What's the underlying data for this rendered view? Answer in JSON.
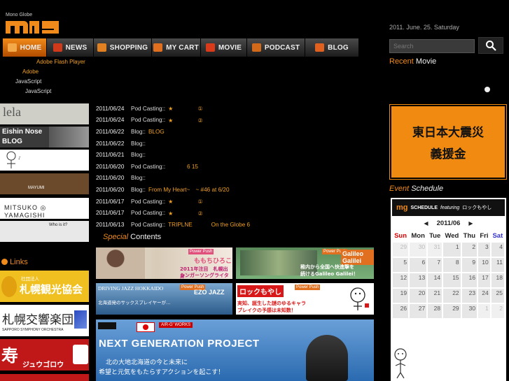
{
  "logo": {
    "small_text": "Mono Globe",
    "mark_text": "mg"
  },
  "nav": [
    {
      "label": "HOME",
      "icon": "home-icon",
      "active": true,
      "color": "#f3a94a"
    },
    {
      "label": "NEWS",
      "icon": "news-icon",
      "active": false,
      "color": "#d03a1a"
    },
    {
      "label": "SHOPPING",
      "icon": "shopping-icon",
      "active": false,
      "color": "#e08020"
    },
    {
      "label": "MY CART",
      "icon": "cart-icon",
      "active": false,
      "color": "#e07020"
    },
    {
      "label": "MOVIE",
      "icon": "movie-icon",
      "active": false,
      "color": "#d83a1a"
    },
    {
      "label": "PODCAST",
      "icon": "podcast-icon",
      "active": false,
      "color": "#d06a1a"
    },
    {
      "label": "BLOG",
      "icon": "blog-icon",
      "active": false,
      "color": "#e06020"
    }
  ],
  "header": {
    "date": "2011. June. 25. Saturday",
    "search_placeholder": "Search"
  },
  "notice": {
    "line1": "Adobe Flash Player",
    "line2": "Adobe",
    "line3": "JavaScript",
    "line4": "JavaScript"
  },
  "recent_movie": {
    "title_hl": "Recent",
    "title_rest": " Movie"
  },
  "left_banners": [
    {
      "name": "lela-banner",
      "text": "lela",
      "bg": "#cfcfc7"
    },
    {
      "name": "eishin-nose-blog-banner",
      "text": "Eishin Nose",
      "text2": "BLOG",
      "bg": "#3a3a3a"
    },
    {
      "name": "character-banner",
      "text": "",
      "bg": "#ffffff"
    },
    {
      "name": "mayumi-banner",
      "text": "MAYUMI",
      "bg": "#6a4a2a"
    },
    {
      "name": "mitsuko-yamagishi-banner",
      "text": "MITSUKO ◎ YAMAGISHI",
      "bg": "#ffffff"
    },
    {
      "name": "who-is-banner",
      "text": "Who is it?",
      "bg": "#e8e8e8"
    }
  ],
  "news": [
    {
      "date": "2011/06/24",
      "cat": "Pod Casting::",
      "title": "★　　　　 ①"
    },
    {
      "date": "2011/06/24",
      "cat": "Pod Casting::",
      "title": "★　　　　 ②"
    },
    {
      "date": "2011/06/22",
      "cat": "Blog::",
      "title": "BLOG"
    },
    {
      "date": "2011/06/22",
      "cat": "Blog::",
      "title": ""
    },
    {
      "date": "2011/06/21",
      "cat": "Blog::",
      "title": ""
    },
    {
      "date": "2011/06/20",
      "cat": "Pod Casting::",
      "title": "　　　 6 15"
    },
    {
      "date": "2011/06/20",
      "cat": "Blog::",
      "title": ""
    },
    {
      "date": "2011/06/20",
      "cat": "Blog::",
      "title": "From My Heart~　~ #46 at 6/20"
    },
    {
      "date": "2011/06/17",
      "cat": "Pod Casting::",
      "title": "★　　　　 ①"
    },
    {
      "date": "2011/06/17",
      "cat": "Pod Casting::",
      "title": "★　　　　 ②"
    },
    {
      "date": "2011/06/13",
      "cat": "Pod Casting::",
      "title": "TRIPLNE　　　 On the Globe 6"
    }
  ],
  "special": {
    "title_hl": "Special",
    "title_rest": " Contents"
  },
  "special_tiles": [
    {
      "name": "momochi-hiroko-tile",
      "line1": "ももちひろこ",
      "line2": "2011年注目　札幌出身",
      "line3": "シンガーソングライター",
      "tag": "Power Push"
    },
    {
      "name": "galileo-galilei-tile",
      "line1": "Galileo Galilei",
      "line2": "稚内から全国へ快進撃を",
      "line3": "続けるGalileo Galilei！",
      "tag": "Power Push"
    },
    {
      "name": "driving-jazz-tile",
      "line1": "DRIVING JAZZ HOKKAIDO",
      "line2": "EZO JAZZ",
      "line3": "北海道発のサックスプレイヤーが…",
      "tag": "Power Push"
    },
    {
      "name": "rokku-moyashi-tile",
      "line1": "ロックもやし",
      "line2": "実知、誕生した謎のゆるキャラ",
      "line3": "ブレイクの予感は未知数！",
      "tag": "Power Push"
    }
  ],
  "next_gen": {
    "title": "NEXT GENERATION PROJECT",
    "line1": "北の大地北海道の今と未来に",
    "line2": "希望と元気をもたらすアクションを起こす！",
    "badge": "AIR-G' WORKS"
  },
  "links": {
    "title": "Links"
  },
  "link_banners": [
    {
      "name": "sapporo-tourism-banner",
      "small": "社団法人",
      "text": "札幌観光協会",
      "bg": "#f0c020",
      "fg": "#fff"
    },
    {
      "name": "sapporo-symphony-banner",
      "text": "札幌交響楽団",
      "sub": "SAPPORO SYMPHONY ORCHESTRA",
      "bg": "#ffffff",
      "fg": "#222"
    },
    {
      "name": "jugoroh-banner",
      "text": "寿",
      "sub": "ジュウゴロウ",
      "bg": "#c01818",
      "fg": "#fff"
    }
  ],
  "earthquake_banner": {
    "line1": "東日本大震災",
    "line2": "義援金",
    "bg": "#f08a10"
  },
  "event_schedule": {
    "title_hl": "Event",
    "title_rest": " Schedule"
  },
  "calendar": {
    "head_logo": "mg",
    "head_text": "SCHEDULE",
    "featuring": "featuring",
    "feat_name": "ロックもやし",
    "prev": "◀",
    "month": "2011/06",
    "next": "▶",
    "days": [
      "Sun",
      "Mon",
      "Tue",
      "Wed",
      "Thu",
      "Fri",
      "Sat"
    ],
    "weeks": [
      [
        "29",
        "30",
        "31",
        "1",
        "2",
        "3",
        "4"
      ],
      [
        "5",
        "6",
        "7",
        "8",
        "9",
        "10",
        "11"
      ],
      [
        "12",
        "13",
        "14",
        "15",
        "16",
        "17",
        "18"
      ],
      [
        "19",
        "20",
        "21",
        "22",
        "23",
        "24",
        "25"
      ],
      [
        "26",
        "27",
        "28",
        "29",
        "30",
        "1",
        "2"
      ]
    ]
  },
  "colors": {
    "accent": "#f08a1a",
    "link": "#f0a020"
  }
}
